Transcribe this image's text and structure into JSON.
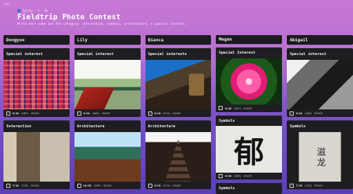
{
  "brand": "jodel",
  "header": {
    "meta": "Galaxy · 3 · 4h",
    "title": "Fieldtrip Photo Contest",
    "subtitle": "Write your name and the category: interaction, symbols, architecture, a special interest."
  },
  "columns": [
    {
      "name": "Dongyoo",
      "cards": [
        {
          "label": "Special interest",
          "score": "8/10",
          "count": "(293)",
          "grade": "GRADE",
          "image": "fabric-photo"
        },
        {
          "label": "Interaction",
          "score": "7/10",
          "count": "(133)",
          "grade": "GRADE",
          "image": "alley-photo"
        }
      ]
    },
    {
      "name": "Lily",
      "cards": [
        {
          "label": "Special interest",
          "score": "9/10",
          "count": "(303)",
          "grade": "GRADE",
          "image": "lake-bridge-photo"
        },
        {
          "label": "Architecture",
          "score": "10/10",
          "count": "(239)",
          "grade": "GRADE",
          "image": "pagoda-roof-photo"
        }
      ]
    },
    {
      "name": "Bianca",
      "cards": [
        {
          "label": "Special interests",
          "score": "9/10",
          "count": "(272)",
          "grade": "GRADE",
          "image": "temple-photo"
        },
        {
          "label": "Architecture",
          "score": "9/10",
          "count": "(174)",
          "grade": "GRADE",
          "image": "tower-photo"
        }
      ]
    },
    {
      "name": "Megan",
      "cards": [
        {
          "label": "Special Interest",
          "score": "9/10",
          "count": "(367)",
          "grade": "GRADE",
          "image": "lily-flower-photo"
        },
        {
          "label": "Symbols",
          "score": "8/10",
          "count": "(183)",
          "grade": "GRADE",
          "image": "calligraphy-photo",
          "glyph": "郁"
        },
        {
          "label": "Symbols"
        }
      ]
    },
    {
      "name": "Abigail",
      "cards": [
        {
          "label": "Special interest",
          "score": "9/10",
          "count": "(105)",
          "grade": "GRADE",
          "image": "bw-photo"
        },
        {
          "label": "Symbols",
          "score": "7/10",
          "count": "(123)",
          "grade": "GRADE",
          "image": "stone-inscription-photo",
          "glyph": "滋龙"
        }
      ]
    }
  ]
}
